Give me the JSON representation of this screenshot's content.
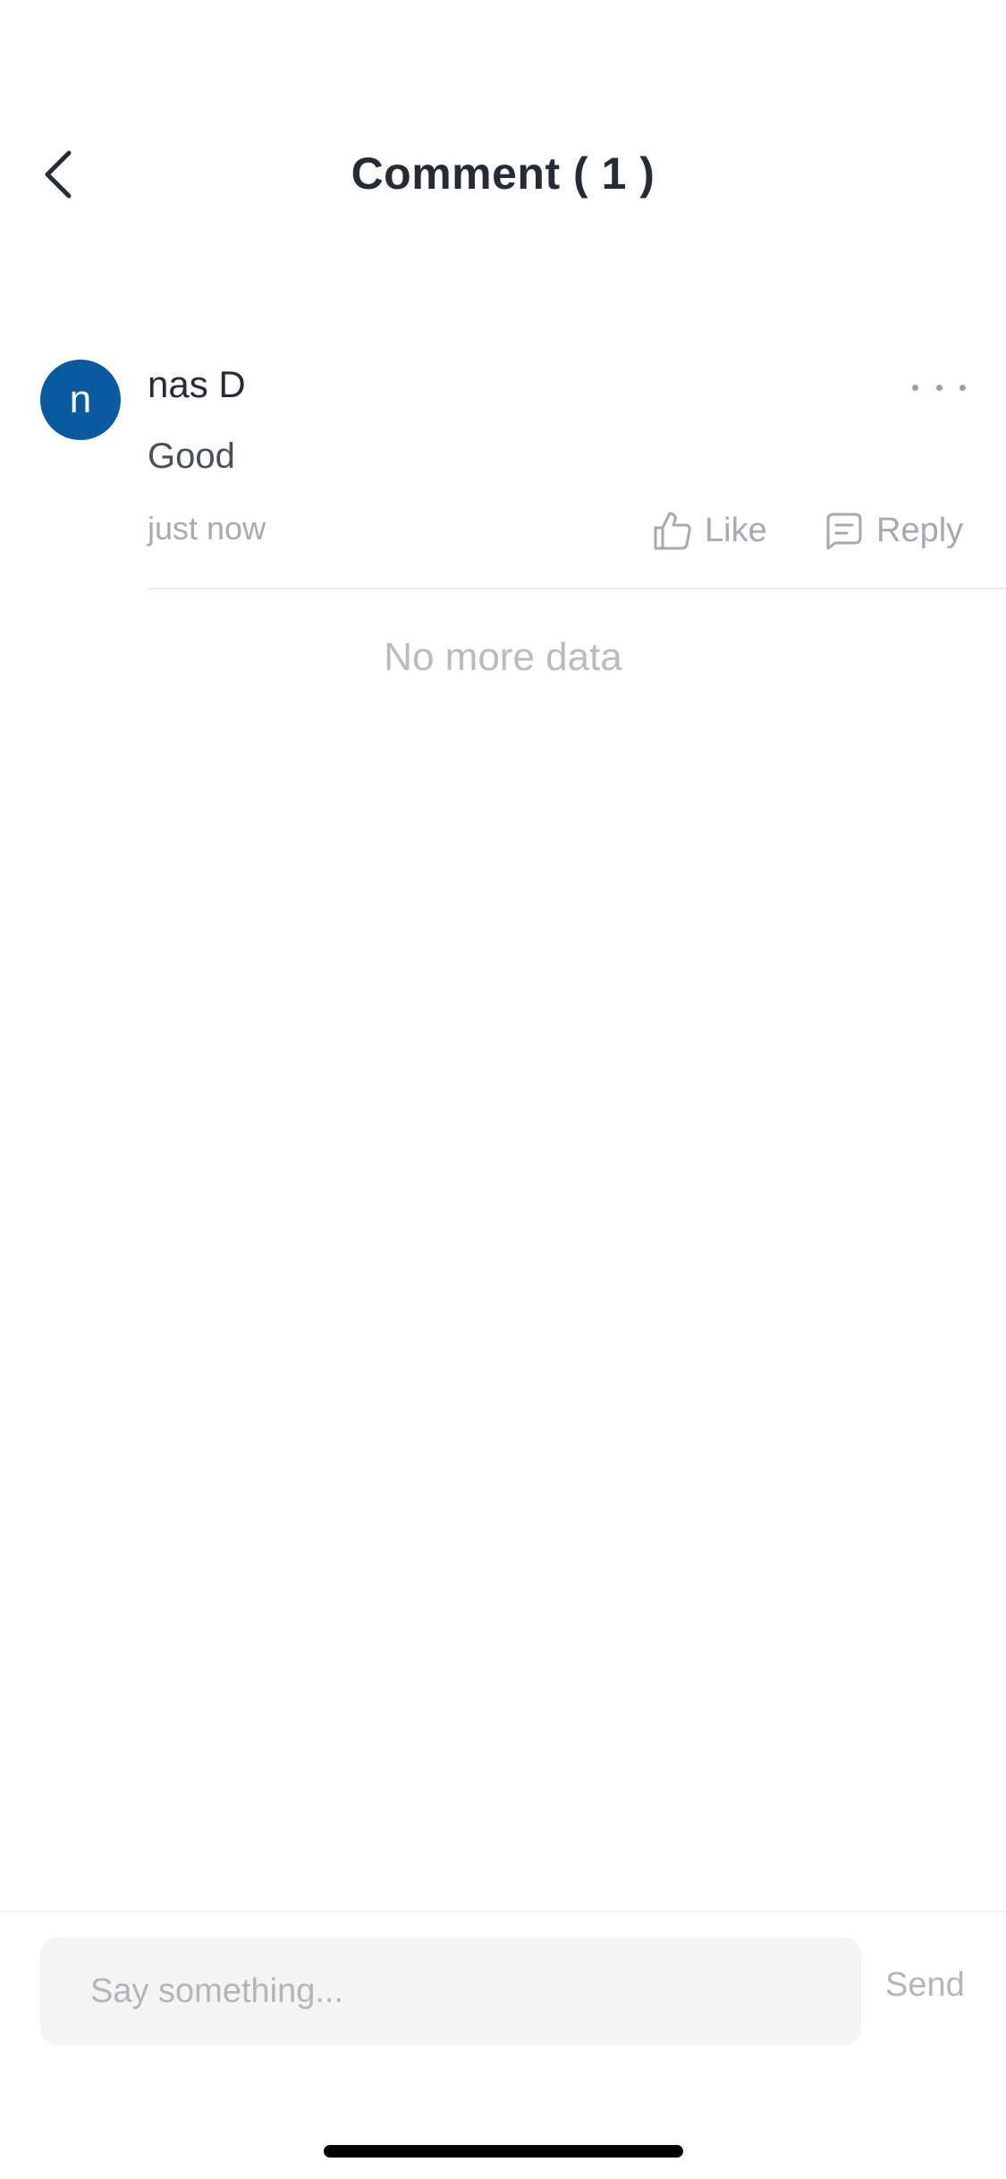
{
  "header": {
    "title": "Comment ( 1 )",
    "back_icon": "chevron-left-icon"
  },
  "comments": [
    {
      "avatar_initial": "n",
      "avatar_color": "#0a5aa0",
      "author": "nas D",
      "text": "Good",
      "time": "just now",
      "like_label": "Like",
      "reply_label": "Reply",
      "more_icon": "more-horizontal-icon"
    }
  ],
  "list_end_text": "No more data",
  "composer": {
    "placeholder": "Say something...",
    "value": "",
    "send_label": "Send"
  },
  "colors": {
    "title": "#262b36",
    "muted": "#a6a9ae",
    "accent": "#0a5aa0",
    "input_bg": "#f4f4f5"
  }
}
